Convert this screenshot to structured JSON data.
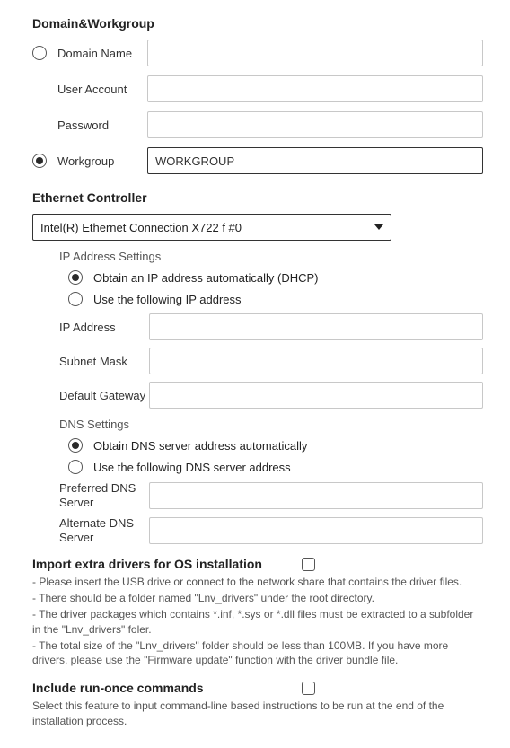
{
  "sections": {
    "domainWorkgroup": {
      "title": "Domain&Workgroup",
      "domainName": {
        "label": "Domain Name",
        "value": ""
      },
      "userAccount": {
        "label": "User Account",
        "value": ""
      },
      "password": {
        "label": "Password",
        "value": ""
      },
      "workgroup": {
        "label": "Workgroup",
        "value": "WORKGROUP"
      }
    },
    "ethernet": {
      "title": "Ethernet Controller",
      "selected": "Intel(R) Ethernet Connection X722 f #0",
      "ipSettings": {
        "heading": "IP Address Settings",
        "optDhcp": "Obtain an IP address automatically (DHCP)",
        "optManual": "Use the following IP address",
        "ipAddress": {
          "label": "IP Address",
          "value": ""
        },
        "subnetMask": {
          "label": "Subnet Mask",
          "value": ""
        },
        "defaultGateway": {
          "label": "Default Gateway",
          "value": ""
        }
      },
      "dnsSettings": {
        "heading": "DNS Settings",
        "optAuto": "Obtain DNS server address automatically",
        "optManual": "Use the following DNS server address",
        "preferred": {
          "label": "Preferred DNS Server",
          "value": ""
        },
        "alternate": {
          "label": "Alternate DNS Server",
          "value": ""
        }
      }
    },
    "importDrivers": {
      "title": "Import extra drivers for OS installation",
      "notes": [
        "- Please insert the USB drive or connect to the network share that contains the driver files.",
        "- There should be a folder named \"Lnv_drivers\" under the root directory.",
        "- The driver packages which contains *.inf, *.sys or *.dll files must be extracted to a subfolder in the \"Lnv_drivers\" foler.",
        "- The total size of the \"Lnv_drivers\" folder should be less than 100MB. If you have more drivers, please use the \"Firmware update\" function with the driver bundle file."
      ]
    },
    "runOnce": {
      "title": "Include run-once commands",
      "note": "Select this feature to input command-line based instructions to be run at the end of the installation process."
    }
  }
}
